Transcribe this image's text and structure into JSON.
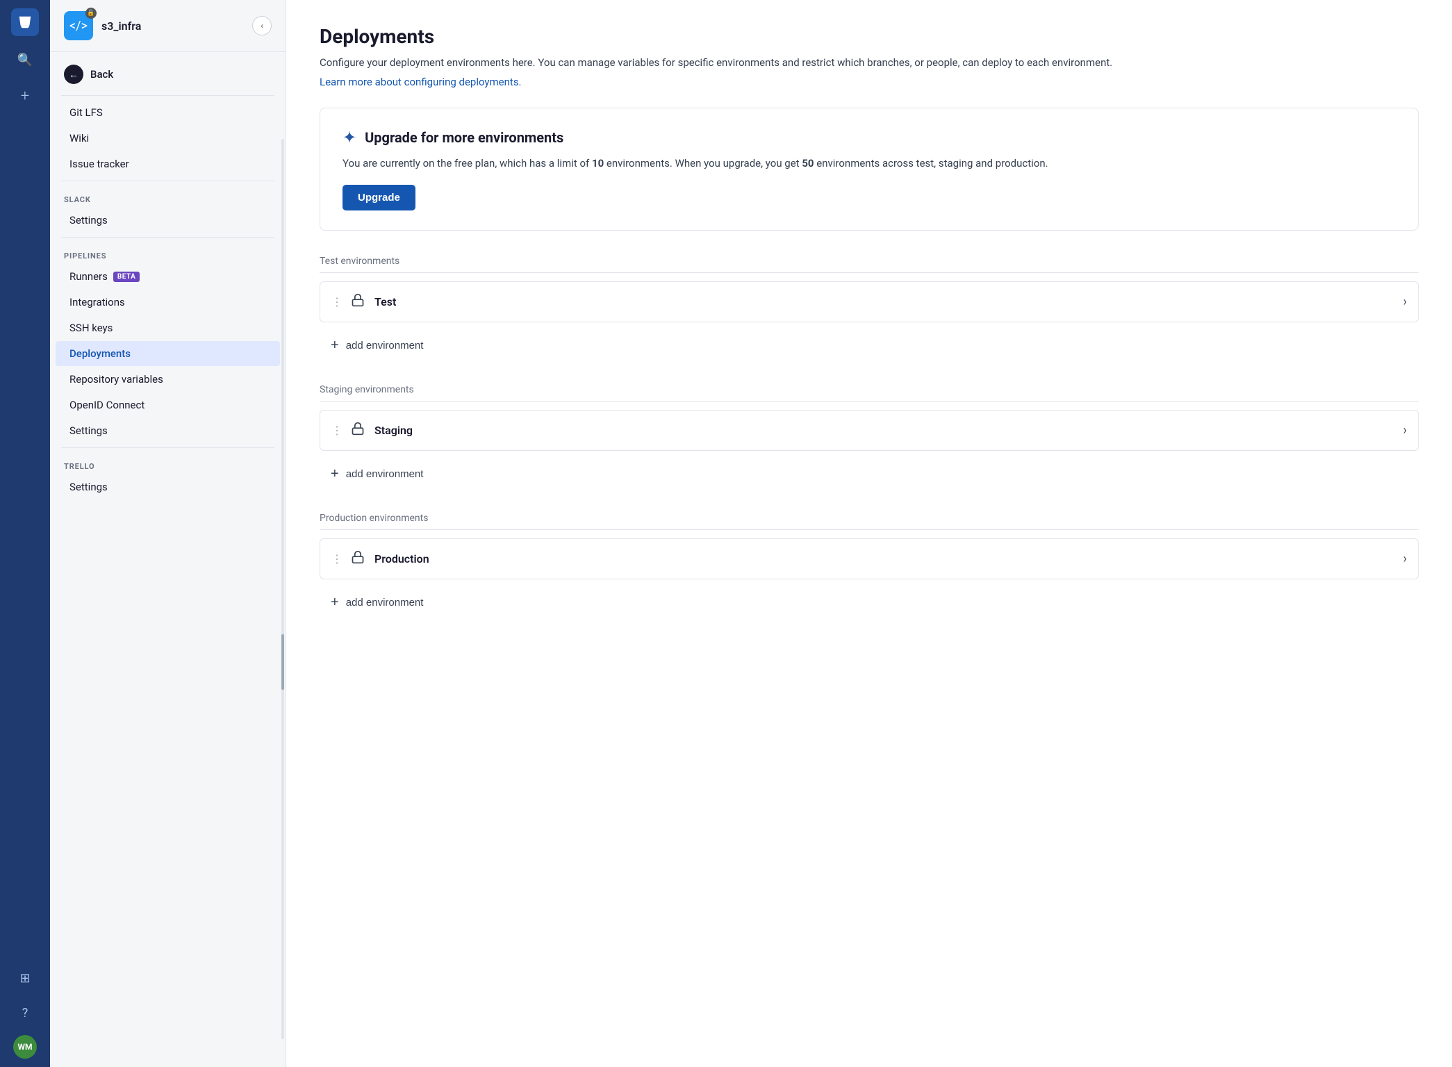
{
  "globalNav": {
    "logoLabel": "Bitbucket",
    "searchIcon": "🔍",
    "addIcon": "+",
    "appsIcon": "⊞",
    "helpIcon": "?",
    "avatar": "WM"
  },
  "sidebar": {
    "repoName": "s3_infra",
    "collapseLabel": "‹",
    "backLabel": "Back",
    "items": [
      {
        "id": "git-lfs",
        "label": "Git LFS",
        "active": false
      },
      {
        "id": "wiki",
        "label": "Wiki",
        "active": false
      },
      {
        "id": "issue-tracker",
        "label": "Issue tracker",
        "active": false
      }
    ],
    "sections": [
      {
        "id": "slack",
        "label": "SLACK",
        "items": [
          {
            "id": "slack-settings",
            "label": "Settings",
            "active": false
          }
        ]
      },
      {
        "id": "pipelines",
        "label": "PIPELINES",
        "items": [
          {
            "id": "runners",
            "label": "Runners",
            "badge": "BETA",
            "active": false
          },
          {
            "id": "integrations",
            "label": "Integrations",
            "active": false
          },
          {
            "id": "ssh-keys",
            "label": "SSH keys",
            "active": false
          },
          {
            "id": "deployments",
            "label": "Deployments",
            "active": true
          },
          {
            "id": "repo-variables",
            "label": "Repository variables",
            "active": false
          },
          {
            "id": "openid-connect",
            "label": "OpenID Connect",
            "active": false
          },
          {
            "id": "pipelines-settings",
            "label": "Settings",
            "active": false
          }
        ]
      },
      {
        "id": "trello",
        "label": "TRELLO",
        "items": [
          {
            "id": "trello-settings",
            "label": "Settings",
            "active": false
          }
        ]
      }
    ]
  },
  "mainContent": {
    "title": "Deployments",
    "description": "Configure your deployment environments here. You can manage variables for specific environments and restrict which branches, or people, can deploy to each environment.",
    "learnMoreText": "Learn more about configuring deployments.",
    "upgradeBanner": {
      "title": "Upgrade for more environments",
      "description": "You are currently on the free plan, which has a limit of ",
      "limit": "10",
      "limitSuffix": " environments. When you upgrade, you get ",
      "upgradedLimit": "50",
      "upgradedSuffix": " environments across test, staging and production.",
      "buttonLabel": "Upgrade"
    },
    "environmentSections": [
      {
        "id": "test",
        "sectionTitle": "Test environments",
        "environments": [
          {
            "id": "test-env",
            "name": "Test"
          }
        ],
        "addLabel": "add environment"
      },
      {
        "id": "staging",
        "sectionTitle": "Staging environments",
        "environments": [
          {
            "id": "staging-env",
            "name": "Staging"
          }
        ],
        "addLabel": "add environment"
      },
      {
        "id": "production",
        "sectionTitle": "Production environments",
        "environments": [
          {
            "id": "production-env",
            "name": "Production"
          }
        ],
        "addLabel": "add environment"
      }
    ]
  }
}
